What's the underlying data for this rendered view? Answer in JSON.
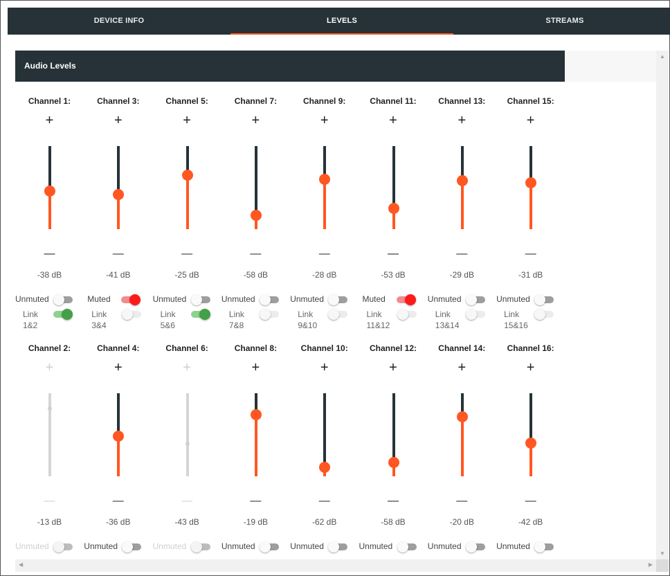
{
  "tabs": {
    "device_info": "DEVICE INFO",
    "levels": "LEVELS",
    "streams": "STREAMS",
    "active": "LEVELS"
  },
  "panel": {
    "title": "Audio Levels"
  },
  "labels": {
    "plus": "+",
    "minus": "—",
    "link": "Link"
  },
  "colors": {
    "accent": "#ff5722",
    "header": "#263238",
    "muted": "#ff1a1a",
    "linked": "#43a047"
  },
  "top_channels": [
    {
      "label": "Channel 1:",
      "db": "-38 dB",
      "level": 0.46,
      "mute_label": "Unmuted",
      "muted": false,
      "link_label": "1&2",
      "linked": true,
      "disabled": false
    },
    {
      "label": "Channel 3:",
      "db": "-41 dB",
      "level": 0.42,
      "mute_label": "Muted",
      "muted": true,
      "link_label": "3&4",
      "linked": false,
      "disabled": false
    },
    {
      "label": "Channel 5:",
      "db": "-25 dB",
      "level": 0.65,
      "mute_label": "Unmuted",
      "muted": false,
      "link_label": "5&6",
      "linked": true,
      "disabled": false
    },
    {
      "label": "Channel 7:",
      "db": "-58 dB",
      "level": 0.17,
      "mute_label": "Unmuted",
      "muted": false,
      "link_label": "7&8",
      "linked": false,
      "disabled": false
    },
    {
      "label": "Channel 9:",
      "db": "-28 dB",
      "level": 0.6,
      "mute_label": "Unmuted",
      "muted": false,
      "link_label": "9&10",
      "linked": false,
      "disabled": false
    },
    {
      "label": "Channel 11:",
      "db": "-53 dB",
      "level": 0.25,
      "mute_label": "Muted",
      "muted": true,
      "link_label": "11&12",
      "linked": false,
      "disabled": false
    },
    {
      "label": "Channel 13:",
      "db": "-29 dB",
      "level": 0.58,
      "mute_label": "Unmuted",
      "muted": false,
      "link_label": "13&14",
      "linked": false,
      "disabled": false
    },
    {
      "label": "Channel 15:",
      "db": "-31 dB",
      "level": 0.56,
      "mute_label": "Unmuted",
      "muted": false,
      "link_label": "15&16",
      "linked": false,
      "disabled": false
    }
  ],
  "bottom_channels": [
    {
      "label": "Channel 2:",
      "db": "-13 dB",
      "level": 0.82,
      "mute_label": "Unmuted",
      "muted": false,
      "disabled": true
    },
    {
      "label": "Channel 4:",
      "db": "-36 dB",
      "level": 0.48,
      "mute_label": "Unmuted",
      "muted": false,
      "disabled": false
    },
    {
      "label": "Channel 6:",
      "db": "-43 dB",
      "level": 0.39,
      "mute_label": "Unmuted",
      "muted": false,
      "disabled": true
    },
    {
      "label": "Channel 8:",
      "db": "-19 dB",
      "level": 0.74,
      "mute_label": "Unmuted",
      "muted": false,
      "disabled": false
    },
    {
      "label": "Channel 10:",
      "db": "-62 dB",
      "level": 0.11,
      "mute_label": "Unmuted",
      "muted": false,
      "disabled": false
    },
    {
      "label": "Channel 12:",
      "db": "-58 dB",
      "level": 0.17,
      "mute_label": "Unmuted",
      "muted": false,
      "disabled": false
    },
    {
      "label": "Channel 14:",
      "db": "-20 dB",
      "level": 0.72,
      "mute_label": "Unmuted",
      "muted": false,
      "disabled": false
    },
    {
      "label": "Channel 16:",
      "db": "-42 dB",
      "level": 0.4,
      "mute_label": "Unmuted",
      "muted": false,
      "disabled": false
    }
  ]
}
